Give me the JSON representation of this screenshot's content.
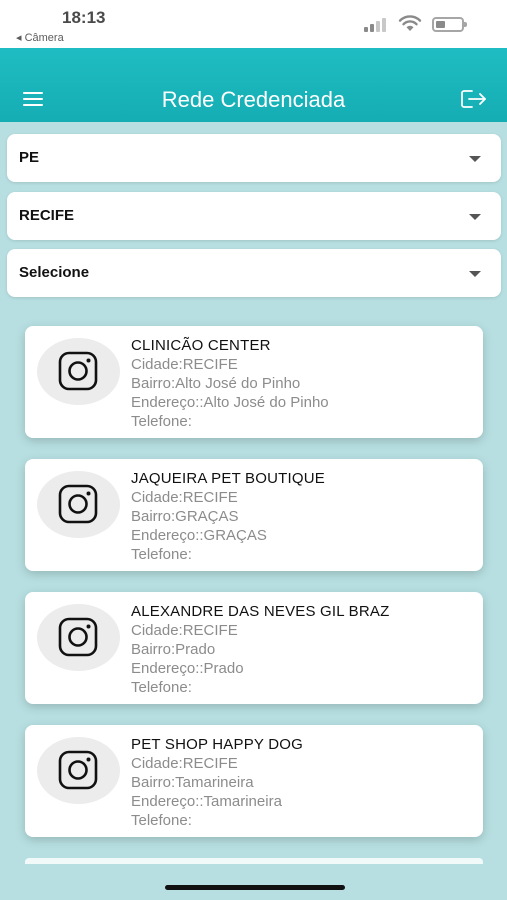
{
  "status_bar": {
    "time": "18:13",
    "back_label": "◂ Câmera"
  },
  "header": {
    "title": "Rede Credenciada",
    "accent_color": "#14adb3"
  },
  "filters": {
    "state": "PE",
    "city": "RECIFE",
    "neighborhood": "Selecione"
  },
  "results": [
    {
      "name": "CLINICÃO CENTER",
      "cidade": "Cidade:RECIFE",
      "bairro": "Bairro:Alto José do Pinho",
      "endereco": "Endereço::Alto José do Pinho",
      "telefone": "Telefone:"
    },
    {
      "name": "JAQUEIRA PET BOUTIQUE",
      "cidade": "Cidade:RECIFE",
      "bairro": "Bairro:GRAÇAS",
      "endereco": "Endereço::GRAÇAS",
      "telefone": "Telefone:"
    },
    {
      "name": "ALEXANDRE DAS NEVES GIL BRAZ",
      "cidade": "Cidade:RECIFE",
      "bairro": "Bairro:Prado",
      "endereco": "Endereço::Prado",
      "telefone": "Telefone:"
    },
    {
      "name": "PET SHOP HAPPY DOG",
      "cidade": "Cidade:RECIFE",
      "bairro": "Bairro:Tamarineira",
      "endereco": "Endereço::Tamarineira",
      "telefone": "Telefone:"
    }
  ],
  "icons": {
    "menu": "menu-icon",
    "logout": "logout-icon",
    "card_avatar": "instagram-icon",
    "dropdown": "chevron-down-icon"
  }
}
